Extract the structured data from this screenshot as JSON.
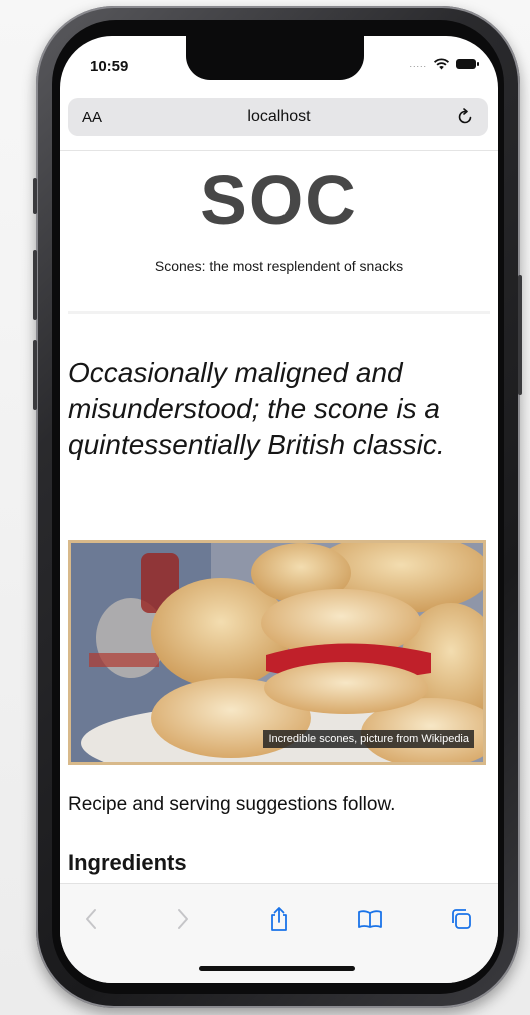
{
  "status_bar": {
    "time": "10:59",
    "cellular": "....."
  },
  "url_bar": {
    "text_size_label": "AA",
    "address": "localhost"
  },
  "page": {
    "logo_text": "SOC",
    "tagline": "Scones: the most resplendent of snacks",
    "lead": "Occasionally maligned and misunderstood; the scone is a quintessentially British classic.",
    "figure_caption": "Incredible scones, picture from Wikipedia",
    "recipe_intro": "Recipe and serving suggestions follow.",
    "ingredients_heading": "Ingredients"
  },
  "toolbar": {
    "buttons": [
      "back-icon",
      "forward-icon",
      "share-icon",
      "bookmarks-icon",
      "tabs-icon"
    ]
  },
  "colors": {
    "accent": "#1a73e8",
    "logo": "#474747",
    "frame": "#d8b98a"
  }
}
